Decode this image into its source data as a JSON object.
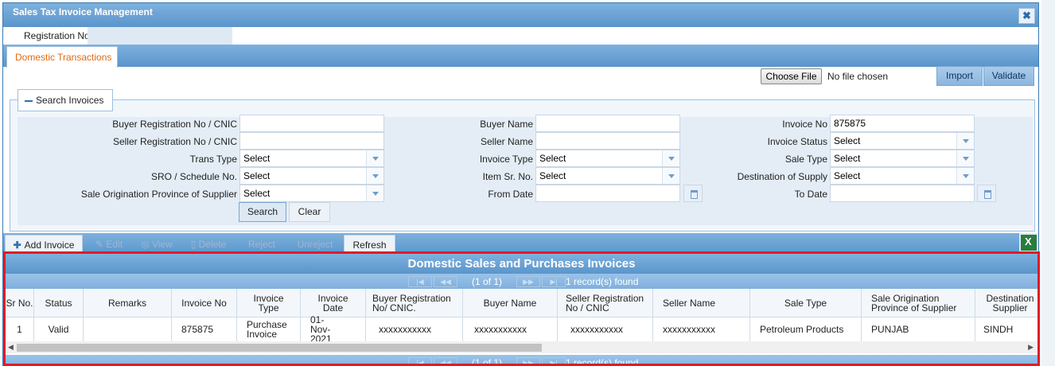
{
  "window": {
    "title": "Sales Tax Invoice Management",
    "close_label": "✖"
  },
  "registration": {
    "label": "Registration No",
    "value": ""
  },
  "tabs": [
    {
      "label": "Domestic Transactions",
      "active": true
    }
  ],
  "file": {
    "choose_label": "Choose File",
    "status": "No file chosen",
    "import_label": "Import",
    "validate_label": "Validate"
  },
  "search": {
    "legend": "Search Invoices",
    "buyer_reg_label": "Buyer Registration No / CNIC",
    "buyer_reg_value": "",
    "seller_reg_label": "Seller Registration No / CNIC",
    "seller_reg_value": "",
    "trans_type_label": "Trans Type",
    "trans_type_value": "Select",
    "sro_label": "SRO / Schedule No.",
    "sro_value": "Select",
    "province_label": "Sale Origination Province of Supplier",
    "province_value": "Select",
    "buyer_name_label": "Buyer Name",
    "buyer_name_value": "",
    "seller_name_label": "Seller Name",
    "seller_name_value": "",
    "invoice_type_label": "Invoice Type",
    "invoice_type_value": "Select",
    "item_sr_label": "Item Sr. No.",
    "item_sr_value": "Select",
    "from_date_label": "From Date",
    "from_date_value": "",
    "invoice_no_label": "Invoice No",
    "invoice_no_value": "875875",
    "invoice_status_label": "Invoice Status",
    "invoice_status_value": "Select",
    "sale_type_label": "Sale Type",
    "sale_type_value": "Select",
    "destination_label": "Destination of Supply",
    "destination_value": "Select",
    "to_date_label": "To Date",
    "to_date_value": "",
    "search_label": "Search",
    "clear_label": "Clear"
  },
  "toolbar": {
    "add": "Add Invoice",
    "edit": "Edit",
    "view": "View",
    "delete": "Delete",
    "reject": "Reject",
    "unreject": "Unreject",
    "refresh": "Refresh"
  },
  "grid": {
    "caption": "Domestic Sales and Purchases Invoices",
    "pager": {
      "page_text": "(1 of 1)",
      "records": "1 record(s) found"
    },
    "columns": [
      "Sr No.",
      "Status",
      "Remarks",
      "Invoice No",
      "Invoice Type",
      "Invoice Date",
      "Buyer Registration No/ CNIC.",
      "Buyer Name",
      "Seller Registration No / CNIC",
      "Seller Name",
      "Sale Type",
      "Sale Origination Province of Supplier",
      "Destination Supplier"
    ],
    "rows": [
      [
        "1",
        "Valid",
        "",
        "875875",
        "Purchase Invoice",
        "01-Nov-2021",
        "xxxxxxxxxxx",
        "xxxxxxxxxxx",
        "xxxxxxxxxxx",
        "xxxxxxxxxxx",
        "Petroleum Products",
        "PUNJAB",
        "SINDH"
      ]
    ]
  }
}
